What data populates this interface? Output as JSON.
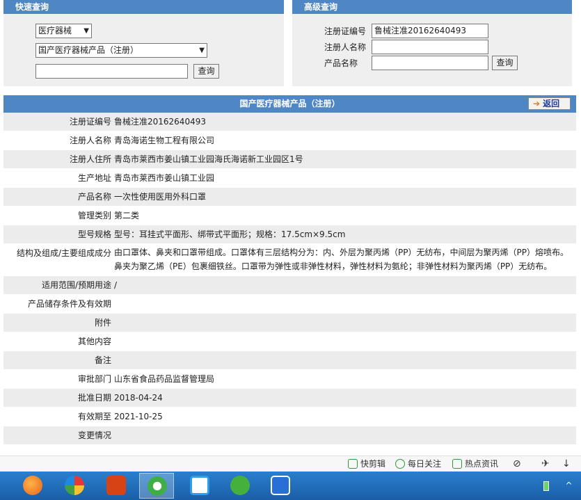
{
  "quick_search": {
    "title": "快速查询",
    "category_select": "医疗器械",
    "type_select": "国产医疗器械产品（注册）",
    "keyword_value": "",
    "search_button": "查询"
  },
  "advanced_search": {
    "title": "高级查询",
    "reg_no_label": "注册证编号",
    "reg_no_value": "鲁械注准20162640493",
    "registrant_label": "注册人名称",
    "registrant_value": "",
    "product_label": "产品名称",
    "product_value": "",
    "search_button": "查询"
  },
  "detail": {
    "title": "国产医疗器械产品（注册）",
    "back_button": "返回",
    "rows": [
      {
        "label": "注册证编号",
        "value": "鲁械注准20162640493"
      },
      {
        "label": "注册人名称",
        "value": "青岛海诺生物工程有限公司"
      },
      {
        "label": "注册人住所",
        "value": "青岛市莱西市姜山镇工业园海氏海诺新工业园区1号"
      },
      {
        "label": "生产地址",
        "value": "青岛市莱西市姜山镇工业园"
      },
      {
        "label": "产品名称",
        "value": "一次性使用医用外科口罩"
      },
      {
        "label": "管理类别",
        "value": "第二类"
      },
      {
        "label": "型号规格",
        "value": "型号：耳挂式平面形、绑带式平面形；规格：17.5cm×9.5cm"
      },
      {
        "label": "结构及组成/主要组成成分",
        "value": "由口罩体、鼻夹和口罩带组成。口罩体有三层结构分为：内、外层为聚丙烯（PP）无纺布，中间层为聚丙烯（PP）熔喷布。鼻夹为聚乙烯（PE）包裹细铁丝。口罩带为弹性或非弹性材料，弹性材料为氨纶；非弹性材料为聚丙烯（PP）无纺布。"
      },
      {
        "label": "适用范围/预期用途",
        "value": "/"
      },
      {
        "label": "产品储存条件及有效期",
        "value": ""
      },
      {
        "label": "附件",
        "value": ""
      },
      {
        "label": "其他内容",
        "value": ""
      },
      {
        "label": "备注",
        "value": ""
      },
      {
        "label": "审批部门",
        "value": "山东省食品药品监督管理局"
      },
      {
        "label": "批准日期",
        "value": "2018-04-24"
      },
      {
        "label": "有效期至",
        "value": "2021-10-25"
      },
      {
        "label": "变更情况",
        "value": ""
      }
    ]
  },
  "browser_bar": {
    "items": [
      "快剪辑",
      "每日关注",
      "热点资讯"
    ]
  },
  "colors": {
    "header_blue": "#4f87c4",
    "panel_gray": "#efefef",
    "row_alt": "#ececec",
    "taskbar": "#1f6bb8"
  }
}
